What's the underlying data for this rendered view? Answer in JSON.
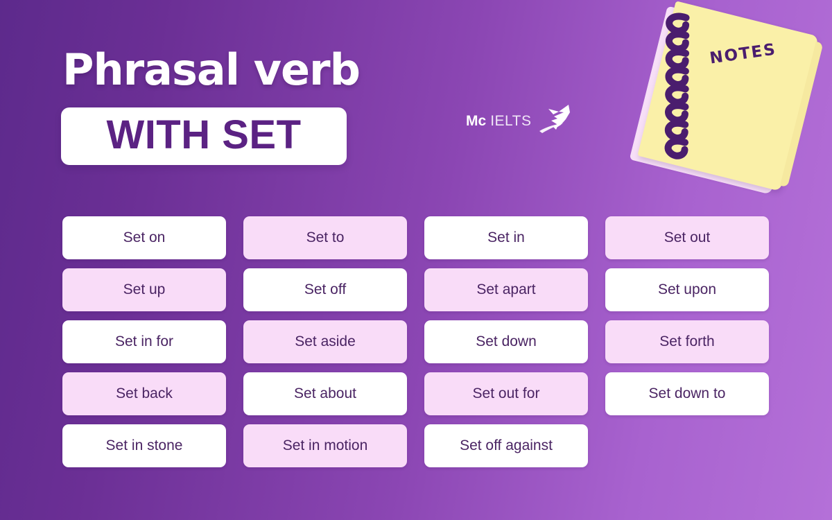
{
  "header": {
    "title_line1": "Phrasal verb",
    "title_line2": "WITH SET",
    "logo": {
      "brand": "Mc",
      "name": "IELTS",
      "icon": "bird-icon"
    }
  },
  "notebook": {
    "label": "NOTES",
    "icon": "spiral-notebook-icon"
  },
  "colors": {
    "bg_dark": "#5d2a8c",
    "bg_light": "#b470d8",
    "card_white": "#ffffff",
    "card_pink": "#f9dcf8",
    "text_purple": "#4a2463",
    "badge_text": "#5b2283",
    "notebook_yellow": "#faf0a8",
    "notebook_spiral": "#4a1d6e"
  },
  "grid": {
    "columns": 4,
    "cards": [
      {
        "label": "Set on",
        "style": "white"
      },
      {
        "label": "Set to",
        "style": "pink"
      },
      {
        "label": "Set in",
        "style": "white"
      },
      {
        "label": "Set out",
        "style": "pink"
      },
      {
        "label": "Set up",
        "style": "pink"
      },
      {
        "label": "Set off",
        "style": "white"
      },
      {
        "label": "Set apart",
        "style": "pink"
      },
      {
        "label": "Set upon",
        "style": "white"
      },
      {
        "label": "Set in for",
        "style": "white"
      },
      {
        "label": "Set aside",
        "style": "pink"
      },
      {
        "label": "Set down",
        "style": "white"
      },
      {
        "label": "Set forth",
        "style": "pink"
      },
      {
        "label": "Set back",
        "style": "pink"
      },
      {
        "label": "Set about",
        "style": "white"
      },
      {
        "label": "Set out for",
        "style": "pink"
      },
      {
        "label": "Set down to",
        "style": "white"
      },
      {
        "label": "Set in stone",
        "style": "white"
      },
      {
        "label": "Set in motion",
        "style": "pink"
      },
      {
        "label": "Set off against",
        "style": "white"
      },
      {
        "label": "",
        "style": "empty"
      }
    ]
  }
}
